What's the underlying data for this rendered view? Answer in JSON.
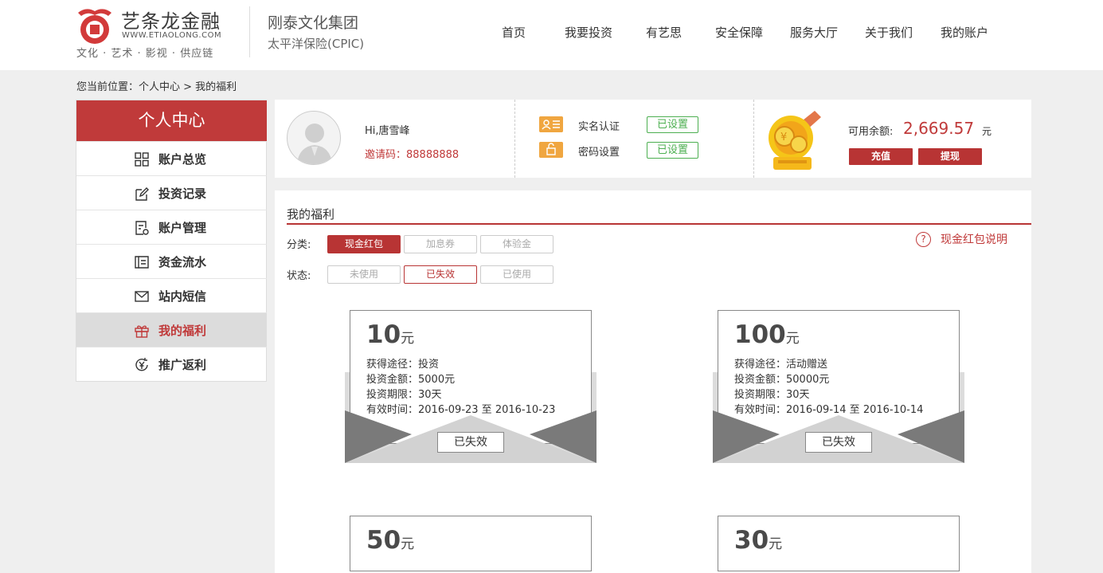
{
  "brand": {
    "name": "艺条龙金融",
    "url": "WWW.ETIAOLONG.COM",
    "tagline": "文化 · 艺术 · 影视 · 供应链",
    "partner_line1": "刚泰文化集团",
    "partner_line2": "太平洋保险(CPIC)"
  },
  "nav": [
    "首页",
    "我要投资",
    "有艺思",
    "安全保障",
    "服务大厅",
    "关于我们",
    "我的账户"
  ],
  "breadcrumb": "您当前位置：个人中心 > 我的福利",
  "sidebar": {
    "title": "个人中心",
    "items": [
      {
        "label": "账户总览",
        "icon": "grid-icon"
      },
      {
        "label": "投资记录",
        "icon": "edit-icon"
      },
      {
        "label": "账户管理",
        "icon": "document-settings-icon"
      },
      {
        "label": "资金流水",
        "icon": "ledger-icon"
      },
      {
        "label": "站内短信",
        "icon": "mail-icon"
      },
      {
        "label": "我的福利",
        "icon": "gift-icon",
        "active": true
      },
      {
        "label": "推广返利",
        "icon": "yen-refresh-icon"
      }
    ]
  },
  "account": {
    "greeting": "Hi,唐雪峰",
    "invite": "邀请码：88888888",
    "realname_label": "实名认证",
    "realname_status": "已设置",
    "password_label": "密码设置",
    "password_status": "已设置",
    "balance_label": "可用余额:",
    "balance_value": "2,669.57",
    "balance_unit": "元",
    "recharge_label": "充值",
    "withdraw_label": "提现"
  },
  "welfare": {
    "title": "我的福利",
    "help": "现金红包说明",
    "category_label": "分类:",
    "categories": [
      "现金红包",
      "加息券",
      "体验金"
    ],
    "status_label": "状态:",
    "statuses": [
      "未使用",
      "已失效",
      "已使用"
    ],
    "coupons": [
      {
        "amount": "10",
        "unit": "元",
        "source": "获得途径：投资",
        "invest_amount": "投资金额：5000元",
        "period": "投资期限：30天",
        "valid": "有效时间：2016-09-23 至 2016-10-23",
        "status": "已失效"
      },
      {
        "amount": "100",
        "unit": "元",
        "source": "获得途径：活动赠送",
        "invest_amount": "投资金额：50000元",
        "period": "投资期限：30天",
        "valid": "有效时间：2016-09-14 至 2016-10-14",
        "status": "已失效"
      },
      {
        "amount": "50",
        "unit": "元"
      },
      {
        "amount": "30",
        "unit": "元"
      }
    ]
  },
  "colors": {
    "brand_red": "#b83434",
    "success_green": "#4caf50",
    "coin_gold": "#f0a640"
  }
}
